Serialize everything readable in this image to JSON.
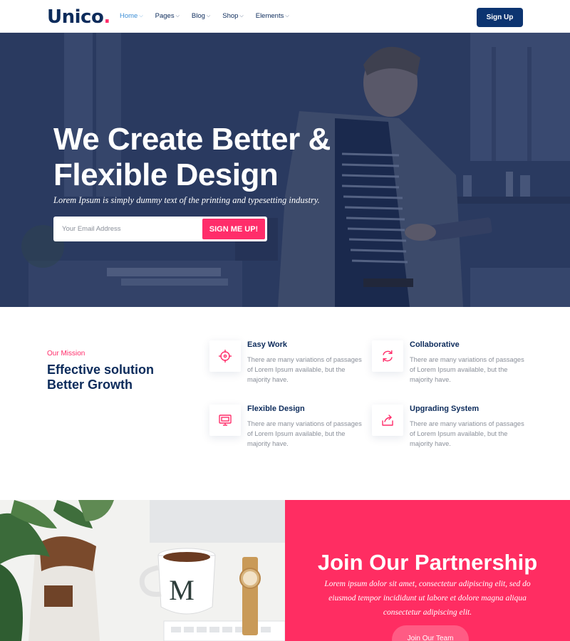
{
  "header": {
    "logo_text": "Unico",
    "logo_dot": ".",
    "nav": [
      {
        "label": "Home"
      },
      {
        "label": "Pages"
      },
      {
        "label": "Blog"
      },
      {
        "label": "Shop"
      },
      {
        "label": "Elements"
      }
    ],
    "signup_label": "Sign Up"
  },
  "hero": {
    "title_line1": "We Create Better &",
    "title_line2": "Flexible Design",
    "subtitle": "Lorem Ipsum is simply dummy text of the printing and typesetting industry.",
    "email_placeholder": "Your Email Address",
    "cta_label": "SIGN ME UP!"
  },
  "mission": {
    "kicker": "Our Mission",
    "title_line1": "Effective solution",
    "title_line2": "Better Growth",
    "features": [
      {
        "title": "Easy Work",
        "desc": "There are many variations of passages of Lorem Ipsum available, but the majority have.",
        "icon": "crosshair-icon"
      },
      {
        "title": "Collaborative",
        "desc": "There are many variations of passages of Lorem Ipsum available, but the majority have.",
        "icon": "refresh-icon"
      },
      {
        "title": "Flexible Design",
        "desc": "There are many variations of passages of Lorem Ipsum available, but the majority have.",
        "icon": "monitor-icon"
      },
      {
        "title": "Upgrading System",
        "desc": "There are many variations of passages of Lorem Ipsum available, but the majority have.",
        "icon": "share-icon"
      }
    ]
  },
  "partnership": {
    "title": "Join Our Partnership",
    "text": "Lorem ipsum dolor sit amet, consectetur adipiscing elit, sed do eiusmod tempor incididunt ut labore et dolore magna aliqua consectetur adipiscing elit.",
    "button_label": "Join Our Team"
  },
  "photo": {
    "mug_letter": "M"
  },
  "colors": {
    "primary": "#0c2b5b",
    "accent": "#ff2d6a",
    "nav_active": "#3d8fd6",
    "button_dark": "#0c3470"
  }
}
